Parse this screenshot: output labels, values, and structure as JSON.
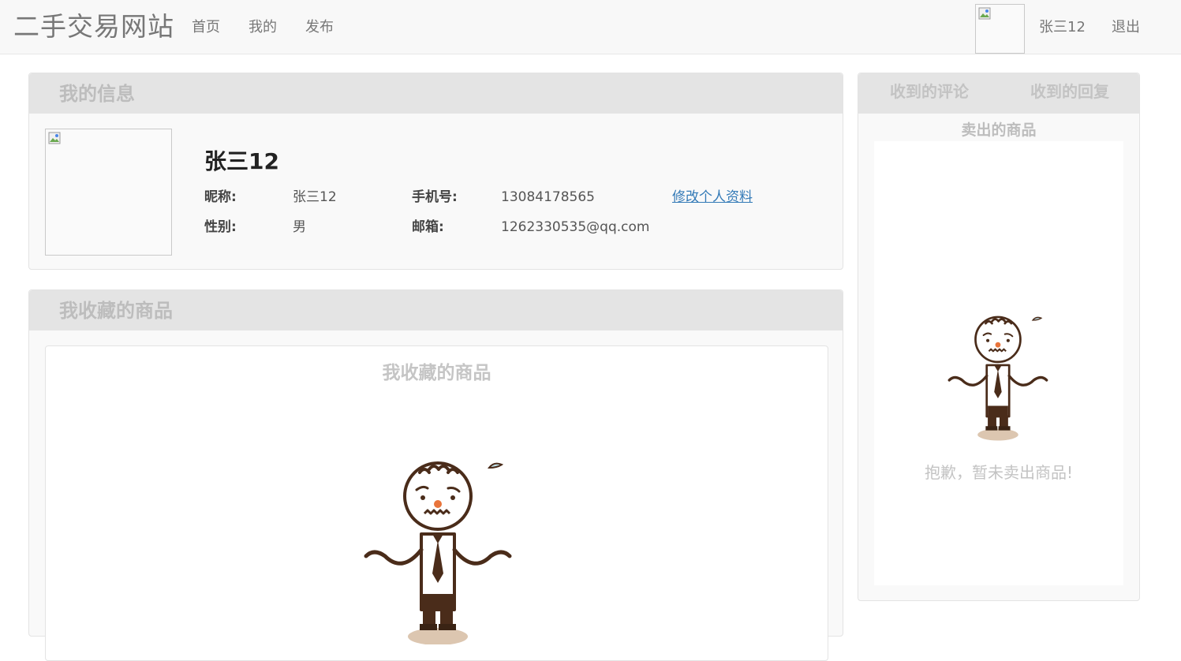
{
  "navbar": {
    "brand": "二手交易网站",
    "links": [
      "首页",
      "我的",
      "发布"
    ],
    "user_name": "张三12",
    "logout": "退出"
  },
  "info_panel": {
    "title": "我的信息",
    "display_name": "张三12",
    "fields": {
      "nickname_label": "昵称:",
      "nickname_value": "张三12",
      "gender_label": "性别:",
      "gender_value": "男",
      "phone_label": "手机号:",
      "phone_value": "13084178565",
      "email_label": "邮箱:",
      "email_value": "1262330535@qq.com"
    },
    "edit_link": "修改个人资料"
  },
  "favorites_panel": {
    "title": "我收藏的商品",
    "inner_title": "我收藏的商品"
  },
  "side_panel": {
    "tabs": [
      "收到的评论",
      "收到的回复"
    ],
    "subtitle": "卖出的商品",
    "empty_message": "抱歉，暂未卖出商品!"
  },
  "colors": {
    "navbar_bg": "#f8f8f8",
    "panel_header": "#e4e4e4",
    "link": "#337ab7",
    "muted_text": "#c3c3c3"
  }
}
